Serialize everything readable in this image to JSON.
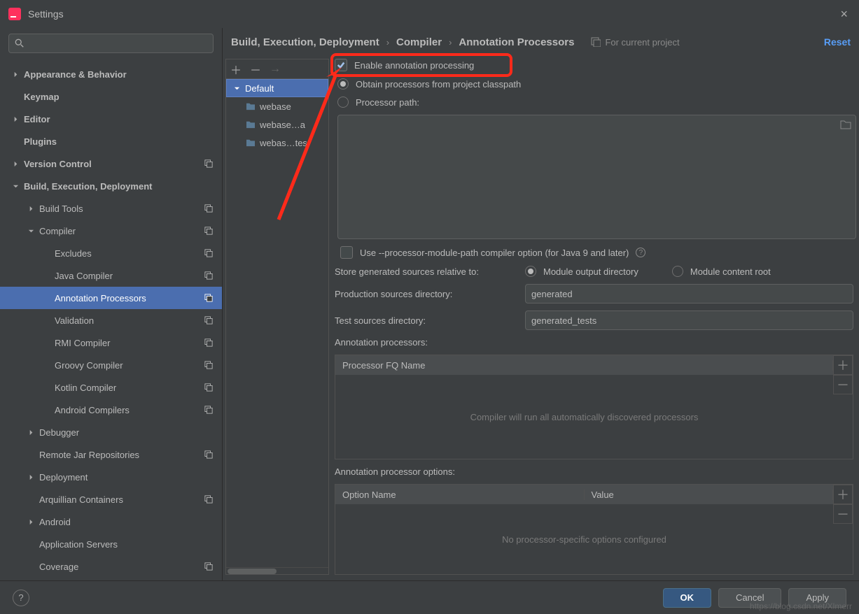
{
  "titlebar": {
    "title": "Settings",
    "close": "×"
  },
  "left": {
    "search_placeholder": "",
    "items": [
      {
        "label": "Appearance & Behavior",
        "depth": 0,
        "chev": "right",
        "icon": false
      },
      {
        "label": "Keymap",
        "depth": 0,
        "chev": "none",
        "icon": false,
        "bold": true
      },
      {
        "label": "Editor",
        "depth": 0,
        "chev": "right",
        "icon": false,
        "bold": true
      },
      {
        "label": "Plugins",
        "depth": 0,
        "chev": "none",
        "icon": false,
        "bold": true
      },
      {
        "label": "Version Control",
        "depth": 0,
        "chev": "right",
        "icon": true,
        "bold": true
      },
      {
        "label": "Build, Execution, Deployment",
        "depth": 0,
        "chev": "down",
        "icon": false,
        "bold": true
      },
      {
        "label": "Build Tools",
        "depth": 1,
        "chev": "right",
        "icon": true
      },
      {
        "label": "Compiler",
        "depth": 1,
        "chev": "down",
        "icon": true
      },
      {
        "label": "Excludes",
        "depth": 2,
        "chev": "none",
        "icon": true
      },
      {
        "label": "Java Compiler",
        "depth": 2,
        "chev": "none",
        "icon": true
      },
      {
        "label": "Annotation Processors",
        "depth": 2,
        "chev": "none",
        "icon": true,
        "selected": true
      },
      {
        "label": "Validation",
        "depth": 2,
        "chev": "none",
        "icon": true
      },
      {
        "label": "RMI Compiler",
        "depth": 2,
        "chev": "none",
        "icon": true
      },
      {
        "label": "Groovy Compiler",
        "depth": 2,
        "chev": "none",
        "icon": true
      },
      {
        "label": "Kotlin Compiler",
        "depth": 2,
        "chev": "none",
        "icon": true
      },
      {
        "label": "Android Compilers",
        "depth": 2,
        "chev": "none",
        "icon": true
      },
      {
        "label": "Debugger",
        "depth": 1,
        "chev": "right",
        "icon": false
      },
      {
        "label": "Remote Jar Repositories",
        "depth": 1,
        "chev": "none",
        "icon": true
      },
      {
        "label": "Deployment",
        "depth": 1,
        "chev": "right",
        "icon": false
      },
      {
        "label": "Arquillian Containers",
        "depth": 1,
        "chev": "none",
        "icon": true
      },
      {
        "label": "Android",
        "depth": 1,
        "chev": "right",
        "icon": false
      },
      {
        "label": "Application Servers",
        "depth": 1,
        "chev": "none",
        "icon": false
      },
      {
        "label": "Coverage",
        "depth": 1,
        "chev": "none",
        "icon": true
      }
    ]
  },
  "crumbs": [
    "Build, Execution, Deployment",
    "Compiler",
    "Annotation Processors"
  ],
  "meta_text": "For current project",
  "reset_label": "Reset",
  "profiles": {
    "root": "Default",
    "items": [
      "webase",
      "webase…a",
      "webas…tes"
    ]
  },
  "opts": {
    "enable_label": "Enable annotation processing",
    "obtain_label": "Obtain processors from project classpath",
    "path_label": "Processor path:",
    "module_path_label": "Use --processor-module-path compiler option (for Java 9 and later)",
    "store_label": "Store generated sources relative to:",
    "radio_module": "Module output directory",
    "radio_content": "Module content root",
    "prod_label": "Production sources directory:",
    "prod_value": "generated",
    "test_label": "Test sources directory:",
    "test_value": "generated_tests",
    "ap_label": "Annotation processors:",
    "ap_col": "Processor FQ Name",
    "ap_empty": "Compiler will run all automatically discovered processors",
    "apo_label": "Annotation processor options:",
    "apo_col1": "Option Name",
    "apo_col2": "Value",
    "apo_empty": "No processor-specific options configured"
  },
  "footer": {
    "ok": "OK",
    "cancel": "Cancel",
    "apply": "Apply",
    "help": "?"
  },
  "watermark": "https://blog.csdn.net/Xlmerr"
}
